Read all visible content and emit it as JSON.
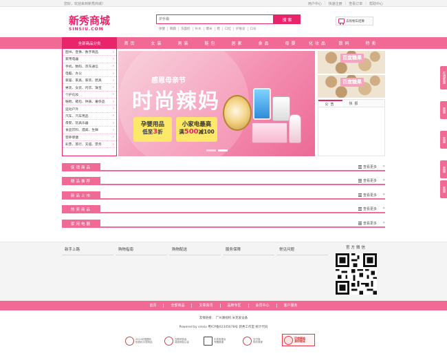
{
  "topbar": {
    "welcome": "您好，欢迎来到新秀商城！",
    "links": [
      "用户中心",
      "快速注册",
      "查看订单",
      "帮助中心"
    ]
  },
  "header": {
    "logo_cn": "新秀商城",
    "logo_en": "SINSIU.COM",
    "search_placeholder": "护手霜",
    "search_button": "搜 索",
    "hot_words": [
      "保健",
      "胸霜",
      "洗面奶",
      "补水",
      "爆米",
      "鞋",
      "口红",
      "护肤皂",
      "口号"
    ],
    "cart_label": "去购物车结算"
  },
  "nav": {
    "all_categories": "全部商品分类",
    "items": [
      "首页",
      "女装",
      "男装",
      "鞋包",
      "居家",
      "食品",
      "母婴",
      "化妆品",
      "数码",
      "特卖"
    ]
  },
  "categories": [
    "图书、音像、数字商品",
    "家用电器",
    "手机、数码、京东通信",
    "电脑、办公",
    "家居、家具、家装、厨具",
    "男装、女装、内衣、珠宝",
    "个护化妆",
    "鞋靴、箱包、钟表、奢侈品",
    "运动户外",
    "汽车、汽车用品",
    "母婴、玩具乐器",
    "食品饮料、酒类、生鲜",
    "营养保健",
    "彩票、旅行、充值、票务"
  ],
  "banner": {
    "subtitle": "感恩母亲节",
    "title": "时尚辣妈",
    "box1_main": "孕婴用品",
    "box1_sub_prefix": "低至",
    "box1_sub_em": "3",
    "box1_sub_suffix": "折",
    "box2_main": "小家电最高",
    "box2_sub_prefix": "满",
    "box2_sub_em": "500",
    "box2_sub_suffix": "减100"
  },
  "ads": {
    "tag1": "百度糖果",
    "tag2": "百度糖果"
  },
  "notice": {
    "tabs": [
      "公告",
      "快报"
    ]
  },
  "floors": {
    "more_label": "查看更多",
    "titles": [
      "促销商品",
      "精品推荐",
      "新品上市",
      "热卖商品",
      "家用电器"
    ]
  },
  "side_tabs": [
    "在线客服",
    "客服",
    "客服",
    "客服",
    "客服"
  ],
  "footer": {
    "help": [
      "新手上路",
      "购物指南",
      "购物配送",
      "服务保障",
      "常见问题"
    ],
    "wechat_label": "官方微信",
    "bottom_nav": [
      "首页",
      "全部商品",
      "文章资讯",
      "品牌专区",
      "会员中心",
      "客户服务"
    ],
    "friend_links": "友情链接： 广州潮视机  米克爱设备",
    "powered": "Powered by sinsiu  粤ICP备02345678号  新秀工作室  统计代码",
    "badges": [
      {
        "line1": "2014中国国际",
        "line2": "信息化示范网站"
      },
      {
        "line1": "互联网协会",
        "line2": "诚信网站认证"
      },
      {
        "line1": "中央电视台",
        "line2": "专题报道"
      },
      {
        "line1": "支付宝",
        "line2": "特约商家"
      },
      {
        "line1": "可信网站",
        "line2": "身份验证"
      }
    ]
  }
}
